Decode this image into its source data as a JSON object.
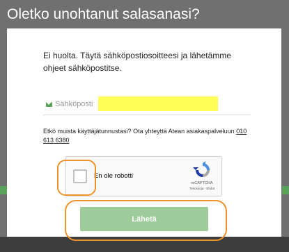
{
  "dialog": {
    "title": "Oletko unohtanut salasanasi?",
    "intro": "Ei huolta. Täytä sähköpostiosoitteesi ja lähetämme ohjeet sähköpostitse.",
    "email": {
      "label": "Sähköposti",
      "value": ""
    },
    "help_text": "Etkö muista käyttäjätunnustasi? Ota yhteyttä Atean asiakaspalveluun",
    "help_phone": "010 613 6380",
    "submit_label": "Lähetä"
  },
  "captcha": {
    "checkbox_label": "En ole robotti",
    "brand": "reCAPTCHA",
    "links": "Tietosuoja - Ehdot"
  },
  "colors": {
    "accent_green": "#5aa35a",
    "button_green": "#9ecb9a",
    "highlight_orange": "#f0922a",
    "email_fill": "#ffff55"
  }
}
